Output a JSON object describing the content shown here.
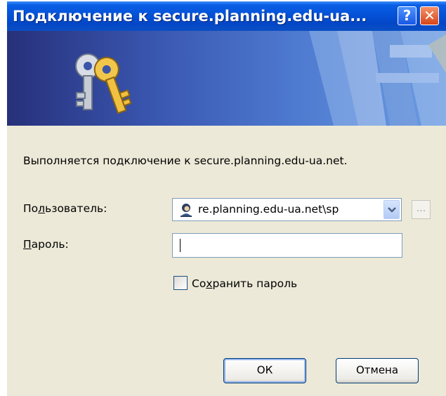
{
  "window": {
    "title": "Подключение к secure.planning.edu-ua...",
    "help_label": "?",
    "close_label": "✕"
  },
  "message": "Выполняется подключение к secure.planning.edu-ua.net.",
  "user_field": {
    "label_pre": "По",
    "label_accel": "л",
    "label_post": "ьзователь:",
    "value": "re.planning.edu-ua.net\\sp",
    "browse_label": "..."
  },
  "password_field": {
    "label_accel": "П",
    "label_post": "ароль:",
    "value": ""
  },
  "save_password": {
    "label_pre": "Со",
    "label_accel": "х",
    "label_post": "ранить пароль",
    "checked": false
  },
  "buttons": {
    "ok": "ОК",
    "cancel": "Отмена"
  },
  "icons": {
    "banner": "keys-icon",
    "user": "user-icon",
    "dropdown": "chevron-down-icon"
  }
}
